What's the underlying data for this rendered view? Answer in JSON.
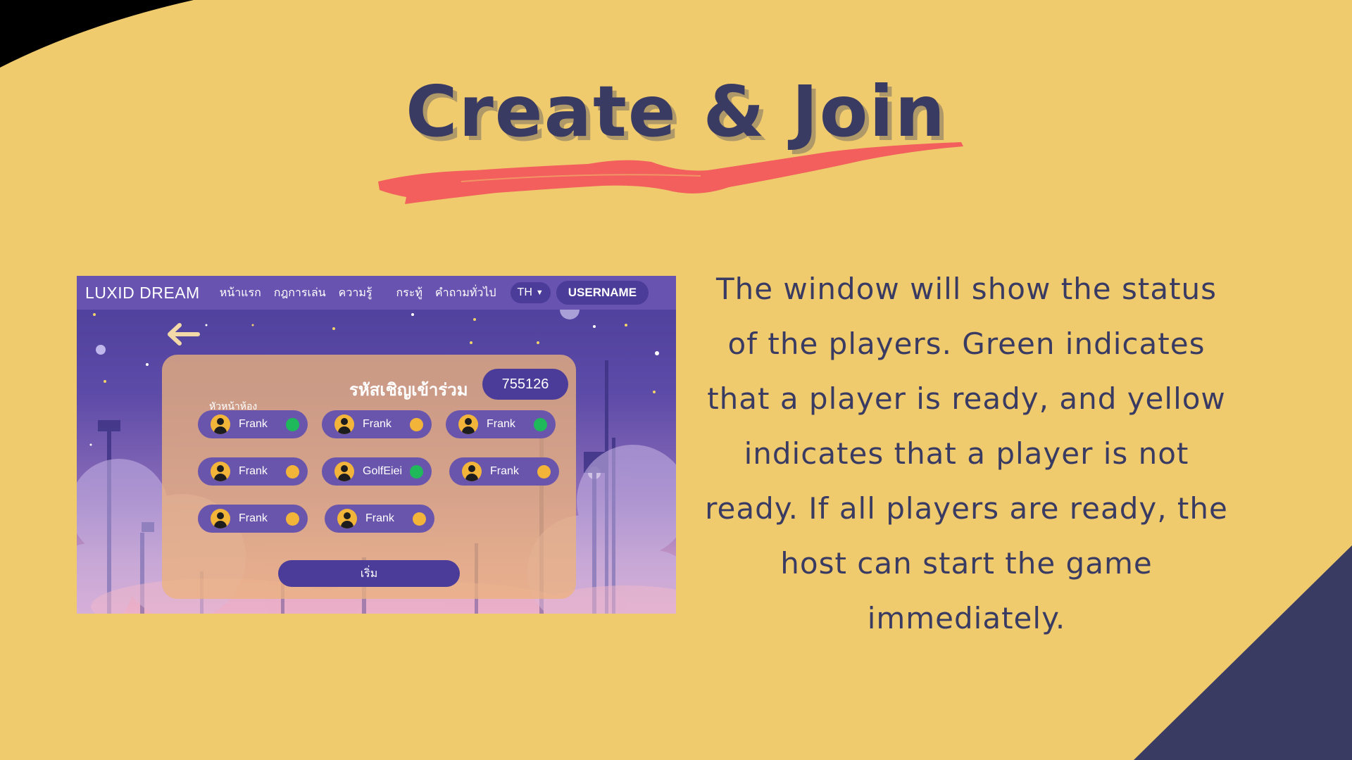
{
  "slide": {
    "title": "Create & Join",
    "description": "The window will show the status of the players. Green indicates that a player is ready, and yellow indicates that a player is not ready. If all players are ready, the host can start the game immediately."
  },
  "colors": {
    "background": "#f0cb6e",
    "ink": "#3a3b62",
    "brush": "#f25f5c",
    "ready": "#1fb85a",
    "not_ready": "#f3b43a"
  },
  "app": {
    "brand": "LUXID DREAM",
    "nav": [
      "หน้าแรก",
      "กฎการเล่น",
      "ความรู้",
      "กระทู้",
      "คำถามทั่วไป"
    ],
    "language": "TH",
    "username": "USERNAME",
    "invite_label": "รหัสเชิญเข้าร่วม",
    "invite_code": "755126",
    "host_label": "หัวหน้าห้อง",
    "start_label": "เริ่ม",
    "players": [
      {
        "name": "Frank",
        "status": "ready"
      },
      {
        "name": "Frank",
        "status": "not_ready"
      },
      {
        "name": "Frank",
        "status": "ready"
      },
      {
        "name": "Frank",
        "status": "not_ready"
      },
      {
        "name": "GolfEiei",
        "status": "ready"
      },
      {
        "name": "Frank",
        "status": "not_ready"
      },
      {
        "name": "Frank",
        "status": "not_ready"
      },
      {
        "name": "Frank",
        "status": "not_ready"
      }
    ],
    "icons": {
      "back": "arrow-left-icon",
      "avatar": "user-avatar-icon",
      "dropdown": "chevron-down-icon"
    }
  }
}
